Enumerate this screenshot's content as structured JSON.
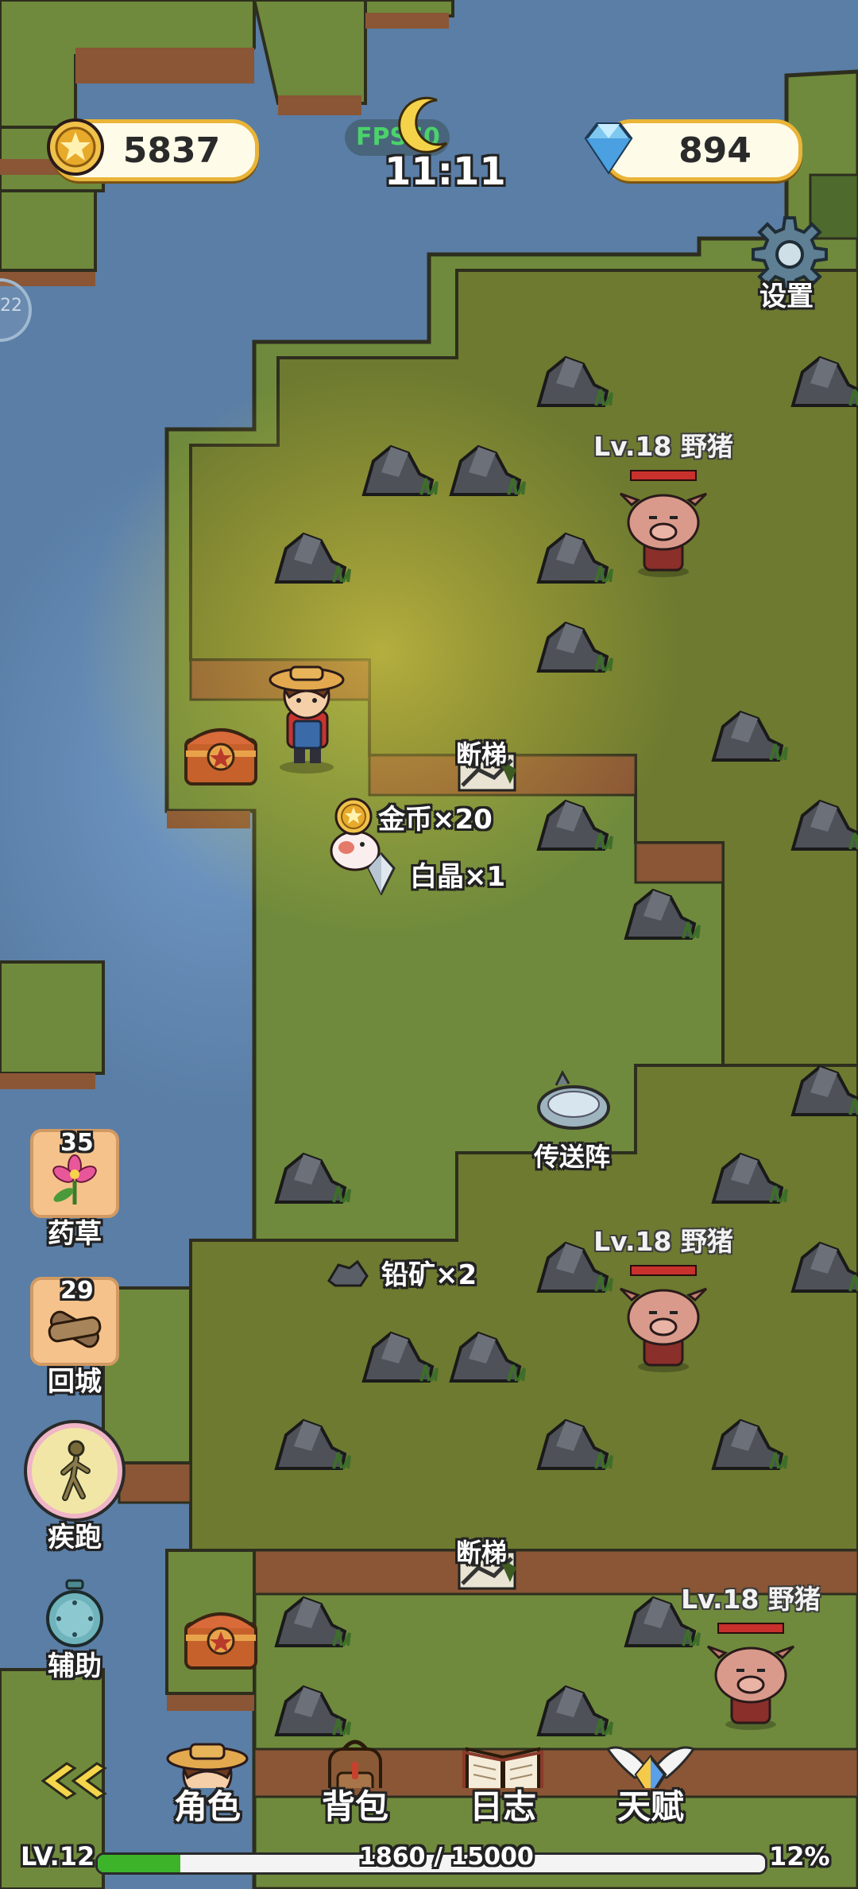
{
  "hud": {
    "gold": "5837",
    "gems": "894",
    "fps": "FPS60",
    "clock": "11:11",
    "settings_label": "设置",
    "side_tab_text": "22"
  },
  "map": {
    "labels": {
      "broken_stairs_1": "断梯",
      "broken_stairs_2": "断梯",
      "teleport": "传送阵"
    },
    "drops": [
      {
        "text": "金币×20",
        "icon": "gold-coin-icon"
      },
      {
        "text": "白晶×1",
        "icon": "white-crystal-icon"
      },
      {
        "text": "铅矿×2",
        "icon": "lead-ore-icon"
      }
    ],
    "enemies": [
      {
        "name": "Lv.18 野猪",
        "hp": 1.0
      },
      {
        "name": "Lv.18 野猪",
        "hp": 1.0
      },
      {
        "name": "Lv.18 野猪",
        "hp": 1.0
      }
    ]
  },
  "side": {
    "herb": {
      "count": "35",
      "label": "药草"
    },
    "return_city": {
      "count": "29",
      "label": "回城"
    },
    "sprint": {
      "label": "疾跑"
    },
    "assist": {
      "label": "辅助"
    }
  },
  "nav": {
    "collapse_icon": "double-chevron-left-icon",
    "character": "角色",
    "bag": "背包",
    "journal": "日志",
    "talent": "天赋"
  },
  "xp": {
    "level": "LV.12",
    "progress_text": "1860 / 15000",
    "percent": "12%",
    "fraction": 0.124
  },
  "colors": {
    "water": "#5a7ea6",
    "grass": "#6f8a3c",
    "grass_dark": "#5c7431",
    "cliff": "#8a5636",
    "xp_fill": "#3cb329"
  }
}
